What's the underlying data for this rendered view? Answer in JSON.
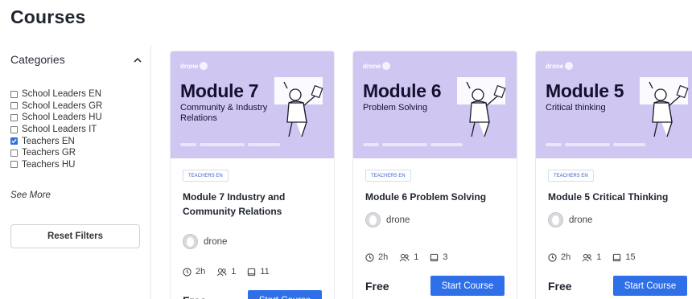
{
  "page": {
    "title": "Courses"
  },
  "sidebar": {
    "categories_title": "Categories",
    "filters": [
      {
        "label": "School Leaders EN",
        "checked": false
      },
      {
        "label": "School Leaders GR",
        "checked": false
      },
      {
        "label": "School Leaders HU",
        "checked": false
      },
      {
        "label": "School Leaders IT",
        "checked": false
      },
      {
        "label": "Teachers EN",
        "checked": true
      },
      {
        "label": "Teachers GR",
        "checked": false
      },
      {
        "label": "Teachers HU",
        "checked": false
      }
    ],
    "see_more": "See More",
    "reset_label": "Reset Filters"
  },
  "courses": [
    {
      "thumb": {
        "brand": "drone",
        "module": "Module 7",
        "subtitle": "Community & Industry Relations"
      },
      "tag": "TEACHERS EN",
      "name": "Module 7 Industry and Community Relations",
      "author": "drone",
      "duration": "2h",
      "students": "1",
      "lessons": "11",
      "price": "Free",
      "cta": "Start Course"
    },
    {
      "thumb": {
        "brand": "drone",
        "module": "Module 6",
        "subtitle": "Problem Solving"
      },
      "tag": "TEACHERS EN",
      "name": "Module 6 Problem Solving",
      "author": "drone",
      "duration": "2h",
      "students": "1",
      "lessons": "3",
      "price": "Free",
      "cta": "Start Course"
    },
    {
      "thumb": {
        "brand": "drone",
        "module": "Module 5",
        "subtitle": "Critical thinking"
      },
      "tag": "TEACHERS EN",
      "name": "Module 5 Critical Thinking",
      "author": "drone",
      "duration": "2h",
      "students": "1",
      "lessons": "15",
      "price": "Free",
      "cta": "Start Course"
    }
  ],
  "colors": {
    "accent": "#2f6fe8",
    "thumb_bg": "#cfc7f2",
    "check": "#2f6fe0"
  },
  "icons": {
    "collapse": "chevron-up-icon",
    "duration": "clock-icon",
    "students": "users-icon",
    "lessons": "book-icon"
  }
}
